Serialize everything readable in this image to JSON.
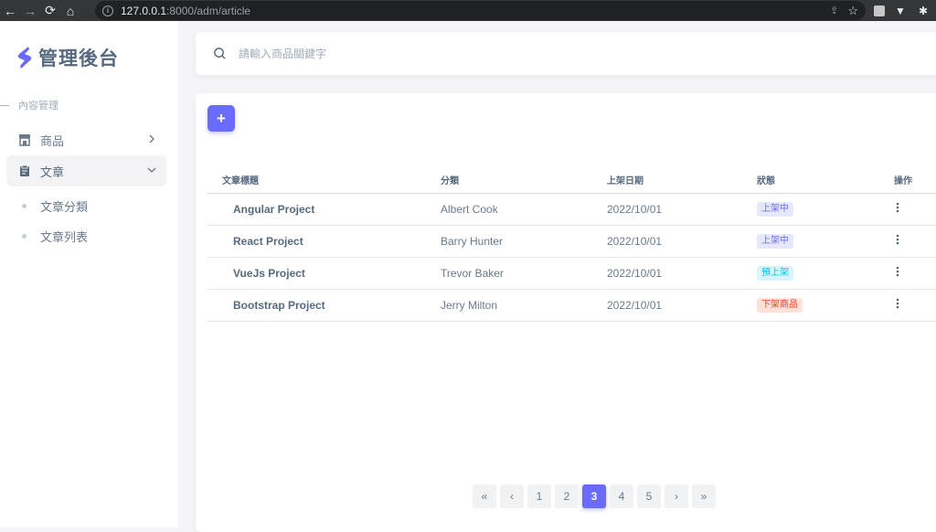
{
  "browser": {
    "url_host": "127.0.0.1",
    "url_path": ":8000/adm/article"
  },
  "sidebar": {
    "brand": "管理後台",
    "section_header": "內容管理",
    "items": [
      {
        "label": "商品",
        "icon": "store-icon",
        "active": false
      },
      {
        "label": "文章",
        "icon": "clipboard-icon",
        "active": true
      }
    ],
    "subitems": [
      {
        "label": "文章分類"
      },
      {
        "label": "文章列表"
      }
    ]
  },
  "search": {
    "placeholder": "請輸入商品關鍵字"
  },
  "toolbar": {
    "add_label": "+"
  },
  "table": {
    "headers": [
      "文章標題",
      "分類",
      "上架日期",
      "狀態",
      "操作"
    ],
    "rows": [
      {
        "title": "Angular Project",
        "category": "Albert Cook",
        "date": "2022/10/01",
        "status": "上架中",
        "status_type": "primary"
      },
      {
        "title": "React Project",
        "category": "Barry Hunter",
        "date": "2022/10/01",
        "status": "上架中",
        "status_type": "primary"
      },
      {
        "title": "VueJs Project",
        "category": "Trevor Baker",
        "date": "2022/10/01",
        "status": "預上架",
        "status_type": "info"
      },
      {
        "title": "Bootstrap Project",
        "category": "Jerry Milton",
        "date": "2022/10/01",
        "status": "下架商品",
        "status_type": "danger"
      }
    ]
  },
  "status_colors": {
    "primary": {
      "bg": "#e7e7ff",
      "fg": "#696cff"
    },
    "info": {
      "bg": "#d7f5fc",
      "fg": "#03c3ec"
    },
    "danger": {
      "bg": "#ffe0db",
      "fg": "#ff3e1d"
    }
  },
  "pagination": {
    "first": "«",
    "prev": "‹",
    "pages": [
      "1",
      "2",
      "3",
      "4",
      "5"
    ],
    "current": "3",
    "next": "›",
    "last": "»"
  },
  "colors": {
    "accent": "#696cff"
  }
}
